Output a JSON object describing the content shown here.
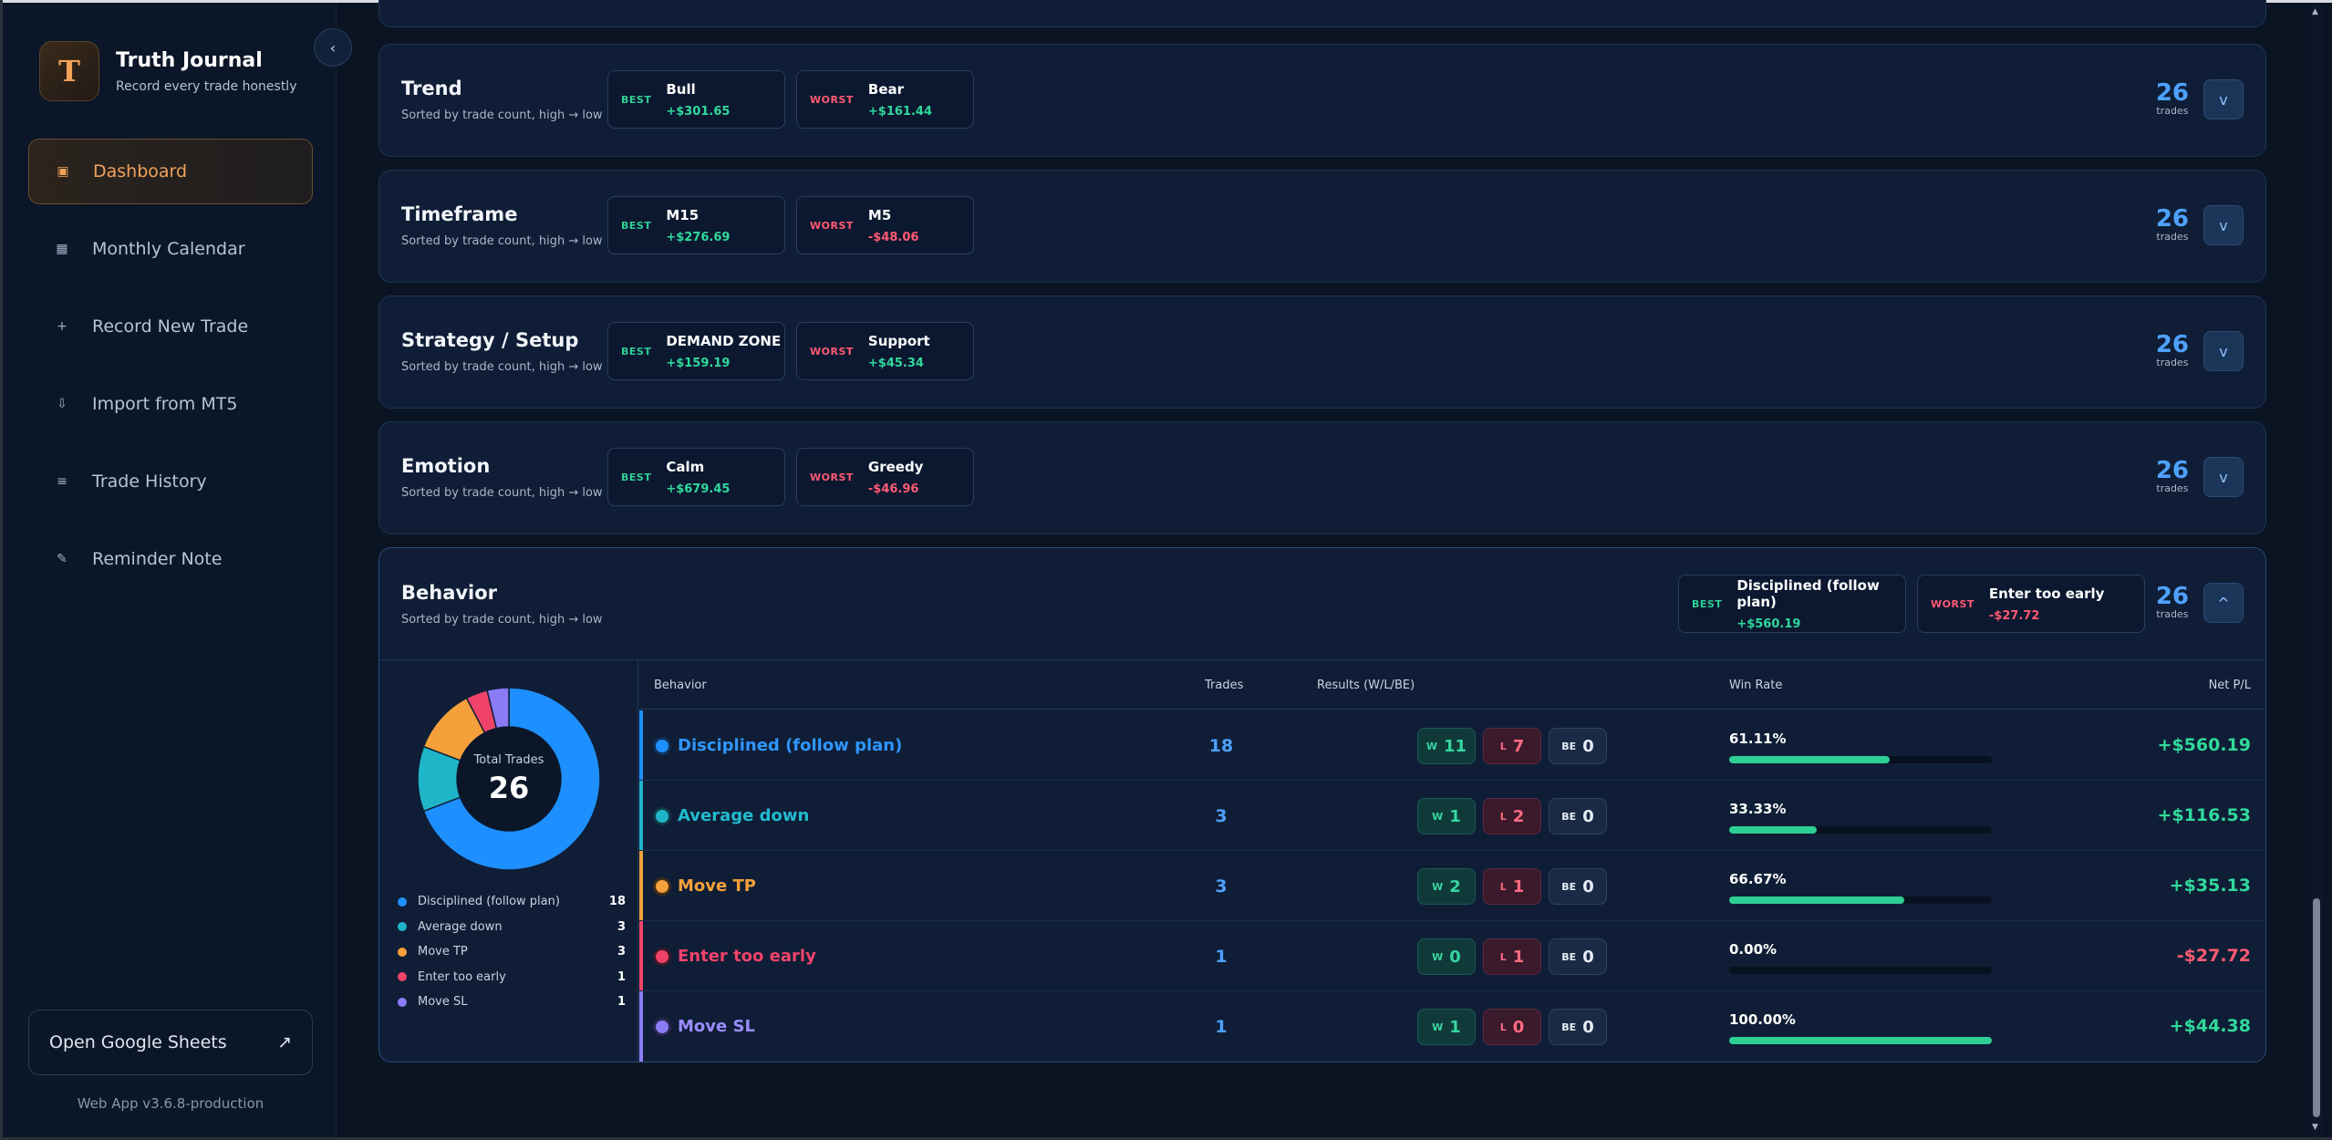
{
  "sidebar": {
    "logo_letter": "T",
    "brand_title": "Truth Journal",
    "brand_subtitle": "Record every trade honestly",
    "collapse_icon": "‹",
    "nav": [
      {
        "label": "Dashboard",
        "icon": "▣",
        "active": true
      },
      {
        "label": "Monthly Calendar",
        "icon": "▦",
        "active": false
      },
      {
        "label": "Record New Trade",
        "icon": "+",
        "active": false
      },
      {
        "label": "Import from MT5",
        "icon": "⇩",
        "active": false
      },
      {
        "label": "Trade History",
        "icon": "≡",
        "active": false
      },
      {
        "label": "Reminder Note",
        "icon": "✎",
        "active": false
      }
    ],
    "sheets_label": "Open Google Sheets",
    "sheets_icon": "↗",
    "version": "Web App v3.6.8-production"
  },
  "sections": [
    {
      "title": "Trend",
      "subtitle": "Sorted by trade count, high → low",
      "best": {
        "tag": "BEST",
        "name": "Bull",
        "value": "+$301.65"
      },
      "worst": {
        "tag": "WORST",
        "name": "Bear",
        "value": "+$161.44"
      },
      "count": "26",
      "count_label": "trades",
      "toggle": "v"
    },
    {
      "title": "Timeframe",
      "subtitle": "Sorted by trade count, high → low",
      "best": {
        "tag": "BEST",
        "name": "M15",
        "value": "+$276.69"
      },
      "worst": {
        "tag": "WORST",
        "name": "M5",
        "value": "-$48.06"
      },
      "count": "26",
      "count_label": "trades",
      "toggle": "v"
    },
    {
      "title": "Strategy / Setup",
      "subtitle": "Sorted by trade count, high → low",
      "best": {
        "tag": "BEST",
        "name": "DEMAND ZONE",
        "value": "+$159.19"
      },
      "worst": {
        "tag": "WORST",
        "name": "Support",
        "value": "+$45.34"
      },
      "count": "26",
      "count_label": "trades",
      "toggle": "v"
    },
    {
      "title": "Emotion",
      "subtitle": "Sorted by trade count, high → low",
      "best": {
        "tag": "BEST",
        "name": "Calm",
        "value": "+$679.45"
      },
      "worst": {
        "tag": "WORST",
        "name": "Greedy",
        "value": "-$46.96"
      },
      "count": "26",
      "count_label": "trades",
      "toggle": "v"
    }
  ],
  "behavior": {
    "title": "Behavior",
    "subtitle": "Sorted by trade count, high → low",
    "best": {
      "tag": "BEST",
      "name": "Disciplined (follow plan)",
      "value": "+$560.19"
    },
    "worst": {
      "tag": "WORST",
      "name": "Enter too early",
      "value": "-$27.72"
    },
    "count": "26",
    "count_label": "trades",
    "toggle": "^",
    "donut_label": "Total Trades",
    "donut_total": "26",
    "headers": {
      "behavior": "Behavior",
      "trades": "Trades",
      "results": "Results (W/L/BE)",
      "win_rate": "Win Rate",
      "net": "Net P/L"
    },
    "chip_labels": {
      "w": "W",
      "l": "L",
      "be": "BE"
    },
    "rows": [
      {
        "name": "Disciplined (follow plan)",
        "color": "#1e8fff",
        "trades": "18",
        "w": "11",
        "l": "7",
        "be": "0",
        "win_rate": "61.11%",
        "win_pct": 61.11,
        "net": "+$560.19",
        "net_class": "pos"
      },
      {
        "name": "Average down",
        "color": "#1fb5c9",
        "trades": "3",
        "w": "1",
        "l": "2",
        "be": "0",
        "win_rate": "33.33%",
        "win_pct": 33.33,
        "net": "+$116.53",
        "net_class": "pos"
      },
      {
        "name": "Move TP",
        "color": "#f5a03a",
        "trades": "3",
        "w": "2",
        "l": "1",
        "be": "0",
        "win_rate": "66.67%",
        "win_pct": 66.67,
        "net": "+$35.13",
        "net_class": "pos"
      },
      {
        "name": "Enter too early",
        "color": "#f0436a",
        "trades": "1",
        "w": "0",
        "l": "1",
        "be": "0",
        "win_rate": "0.00%",
        "win_pct": 0,
        "net": "-$27.72",
        "net_class": "neg"
      },
      {
        "name": "Move SL",
        "color": "#8b7cf6",
        "trades": "1",
        "w": "1",
        "l": "0",
        "be": "0",
        "win_rate": "100.00%",
        "win_pct": 100,
        "net": "+$44.38",
        "net_class": "pos"
      }
    ]
  }
}
